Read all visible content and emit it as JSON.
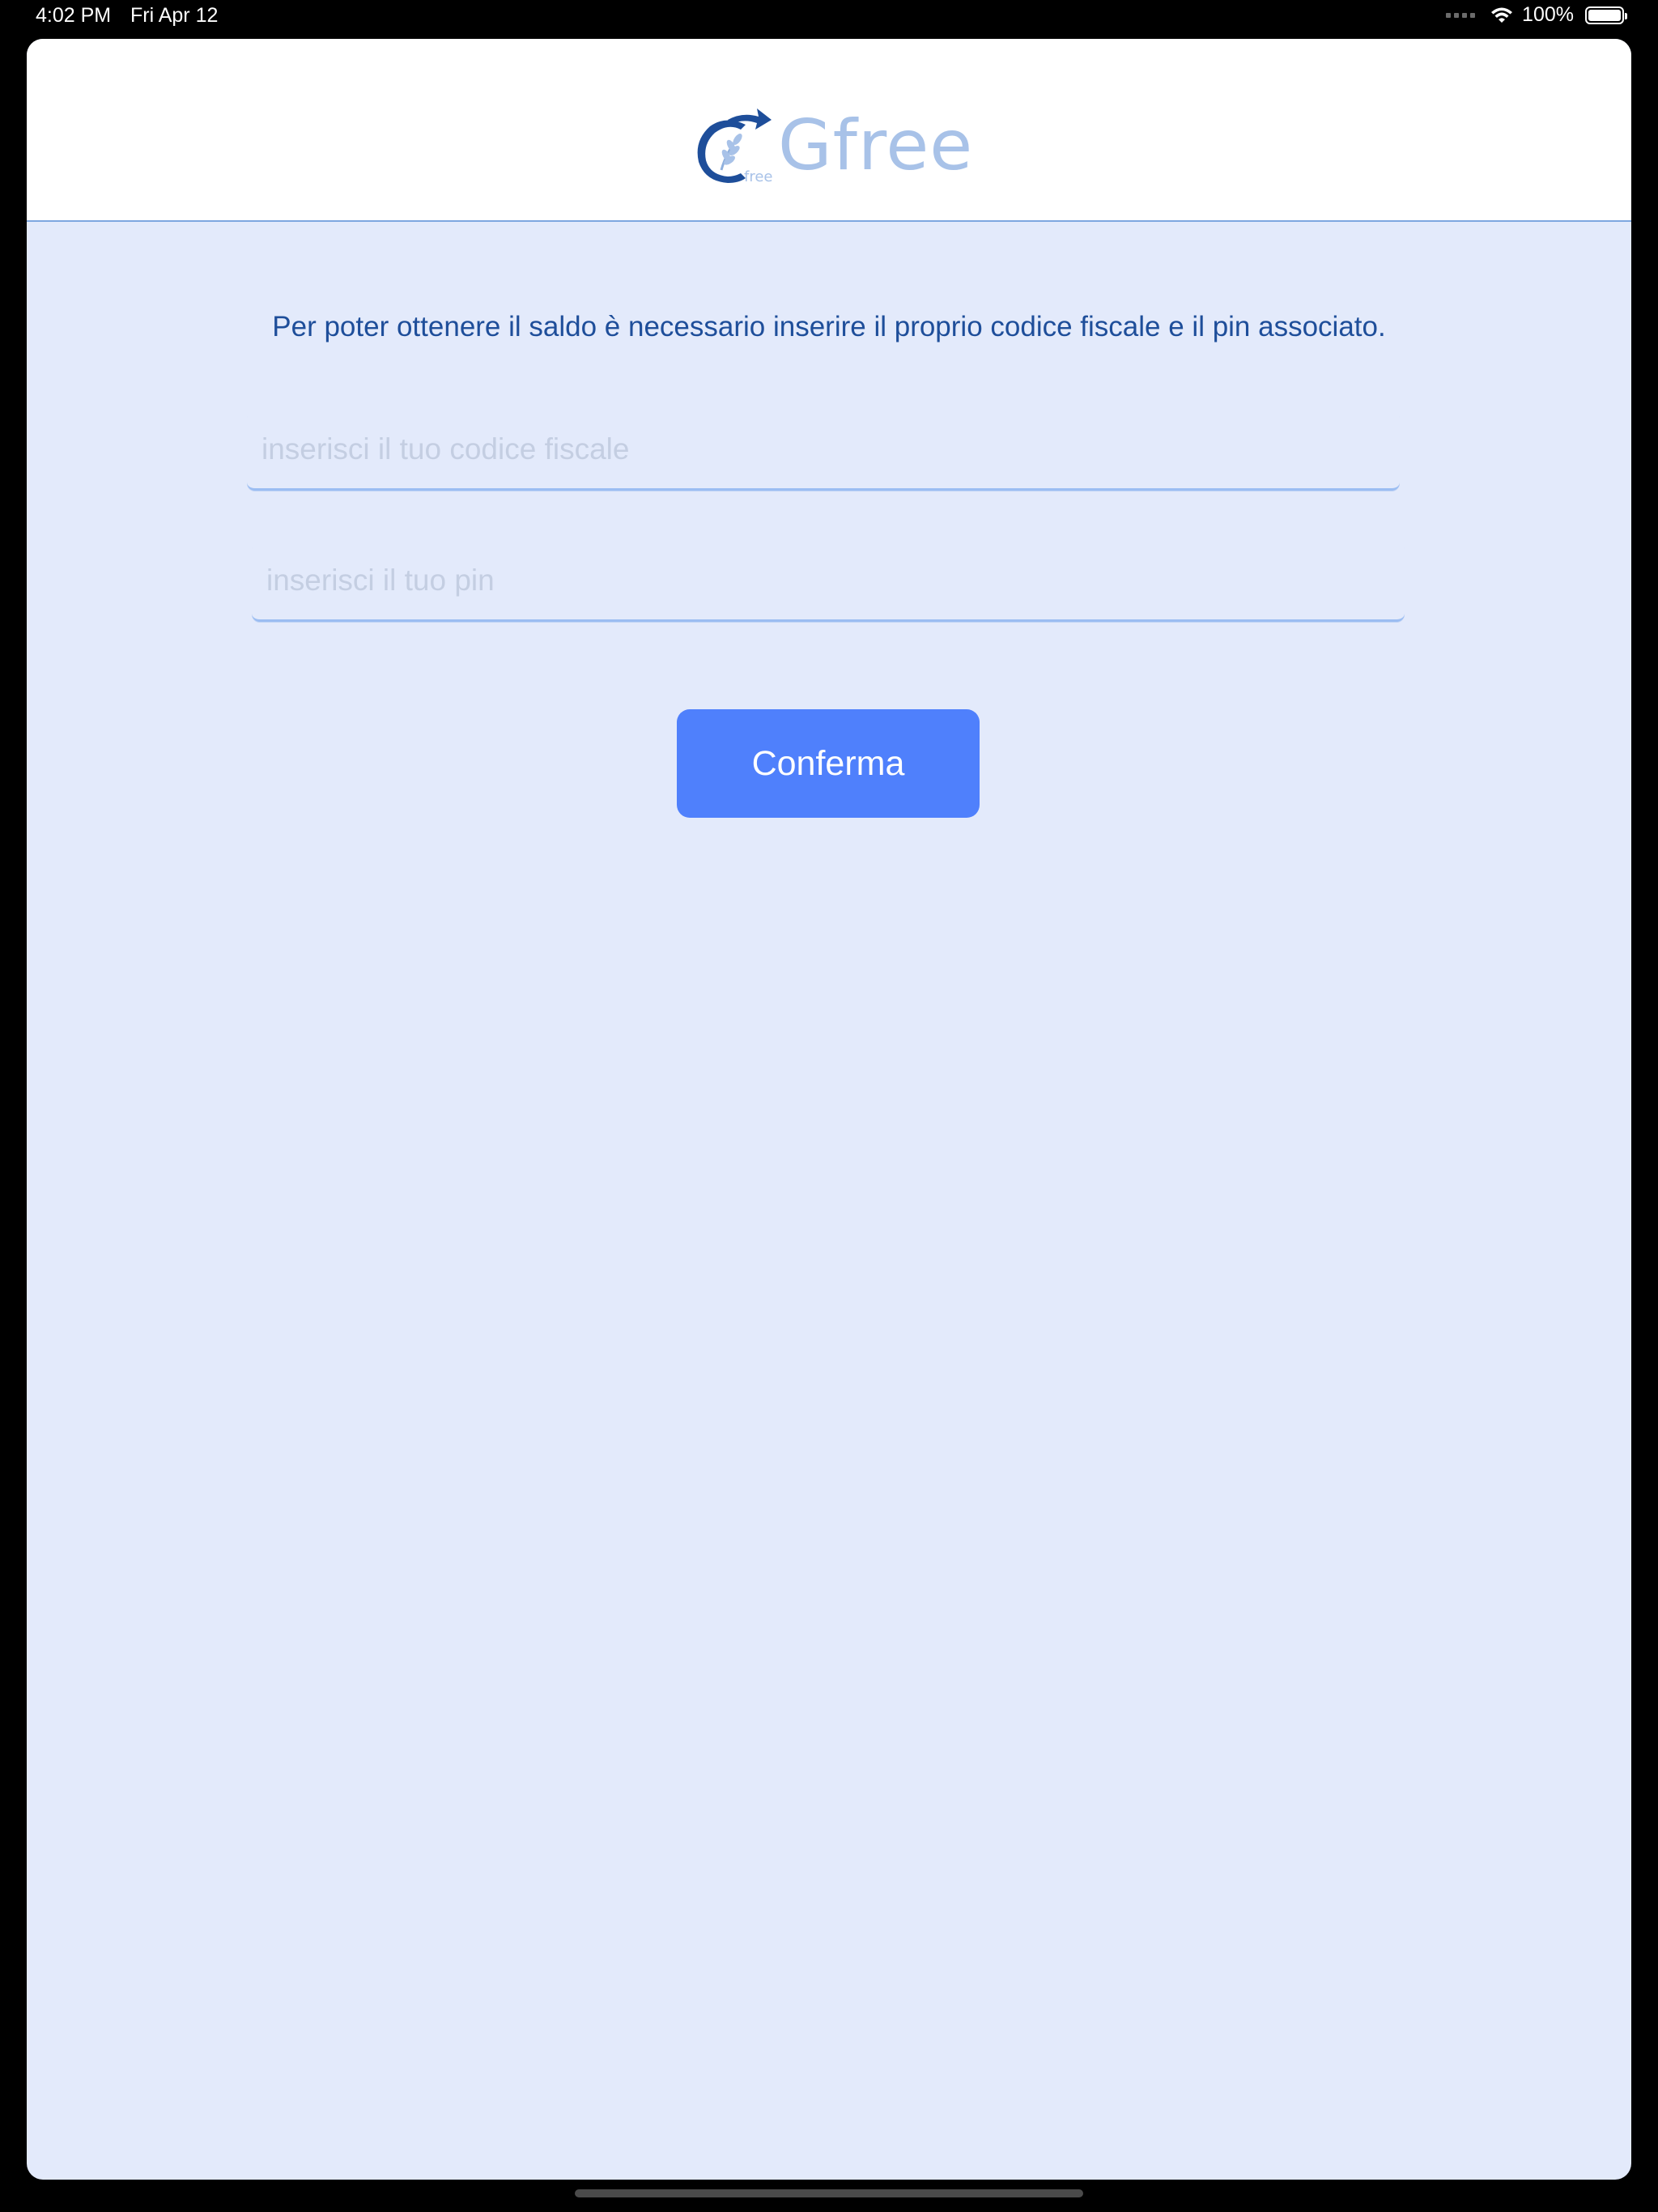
{
  "status_bar": {
    "time": "4:02 PM",
    "date": "Fri Apr 12",
    "battery_percent": "100%",
    "battery_level": 1.0,
    "icons": [
      "cellular-icon",
      "wifi-icon",
      "battery-icon"
    ]
  },
  "header": {
    "logo_text": "Gfree",
    "logo_mark_text": "free"
  },
  "main": {
    "instruction": "Per poter ottenere il saldo è necessario inserire il proprio codice fiscale e il pin associato.",
    "codice_fiscale": {
      "value": "",
      "placeholder": "inserisci il tuo codice fiscale"
    },
    "pin": {
      "value": "",
      "placeholder": "inserisci il tuo pin"
    },
    "confirm_label": "Conferma"
  },
  "colors": {
    "background": "#e3eafb",
    "header_background": "#ffffff",
    "accent": "#4f80fc",
    "text_primary": "#1e4e9a",
    "logo_light": "#a8c2e8",
    "logo_dark": "#1e4e9a",
    "field_underline": "#9bbdf2"
  }
}
